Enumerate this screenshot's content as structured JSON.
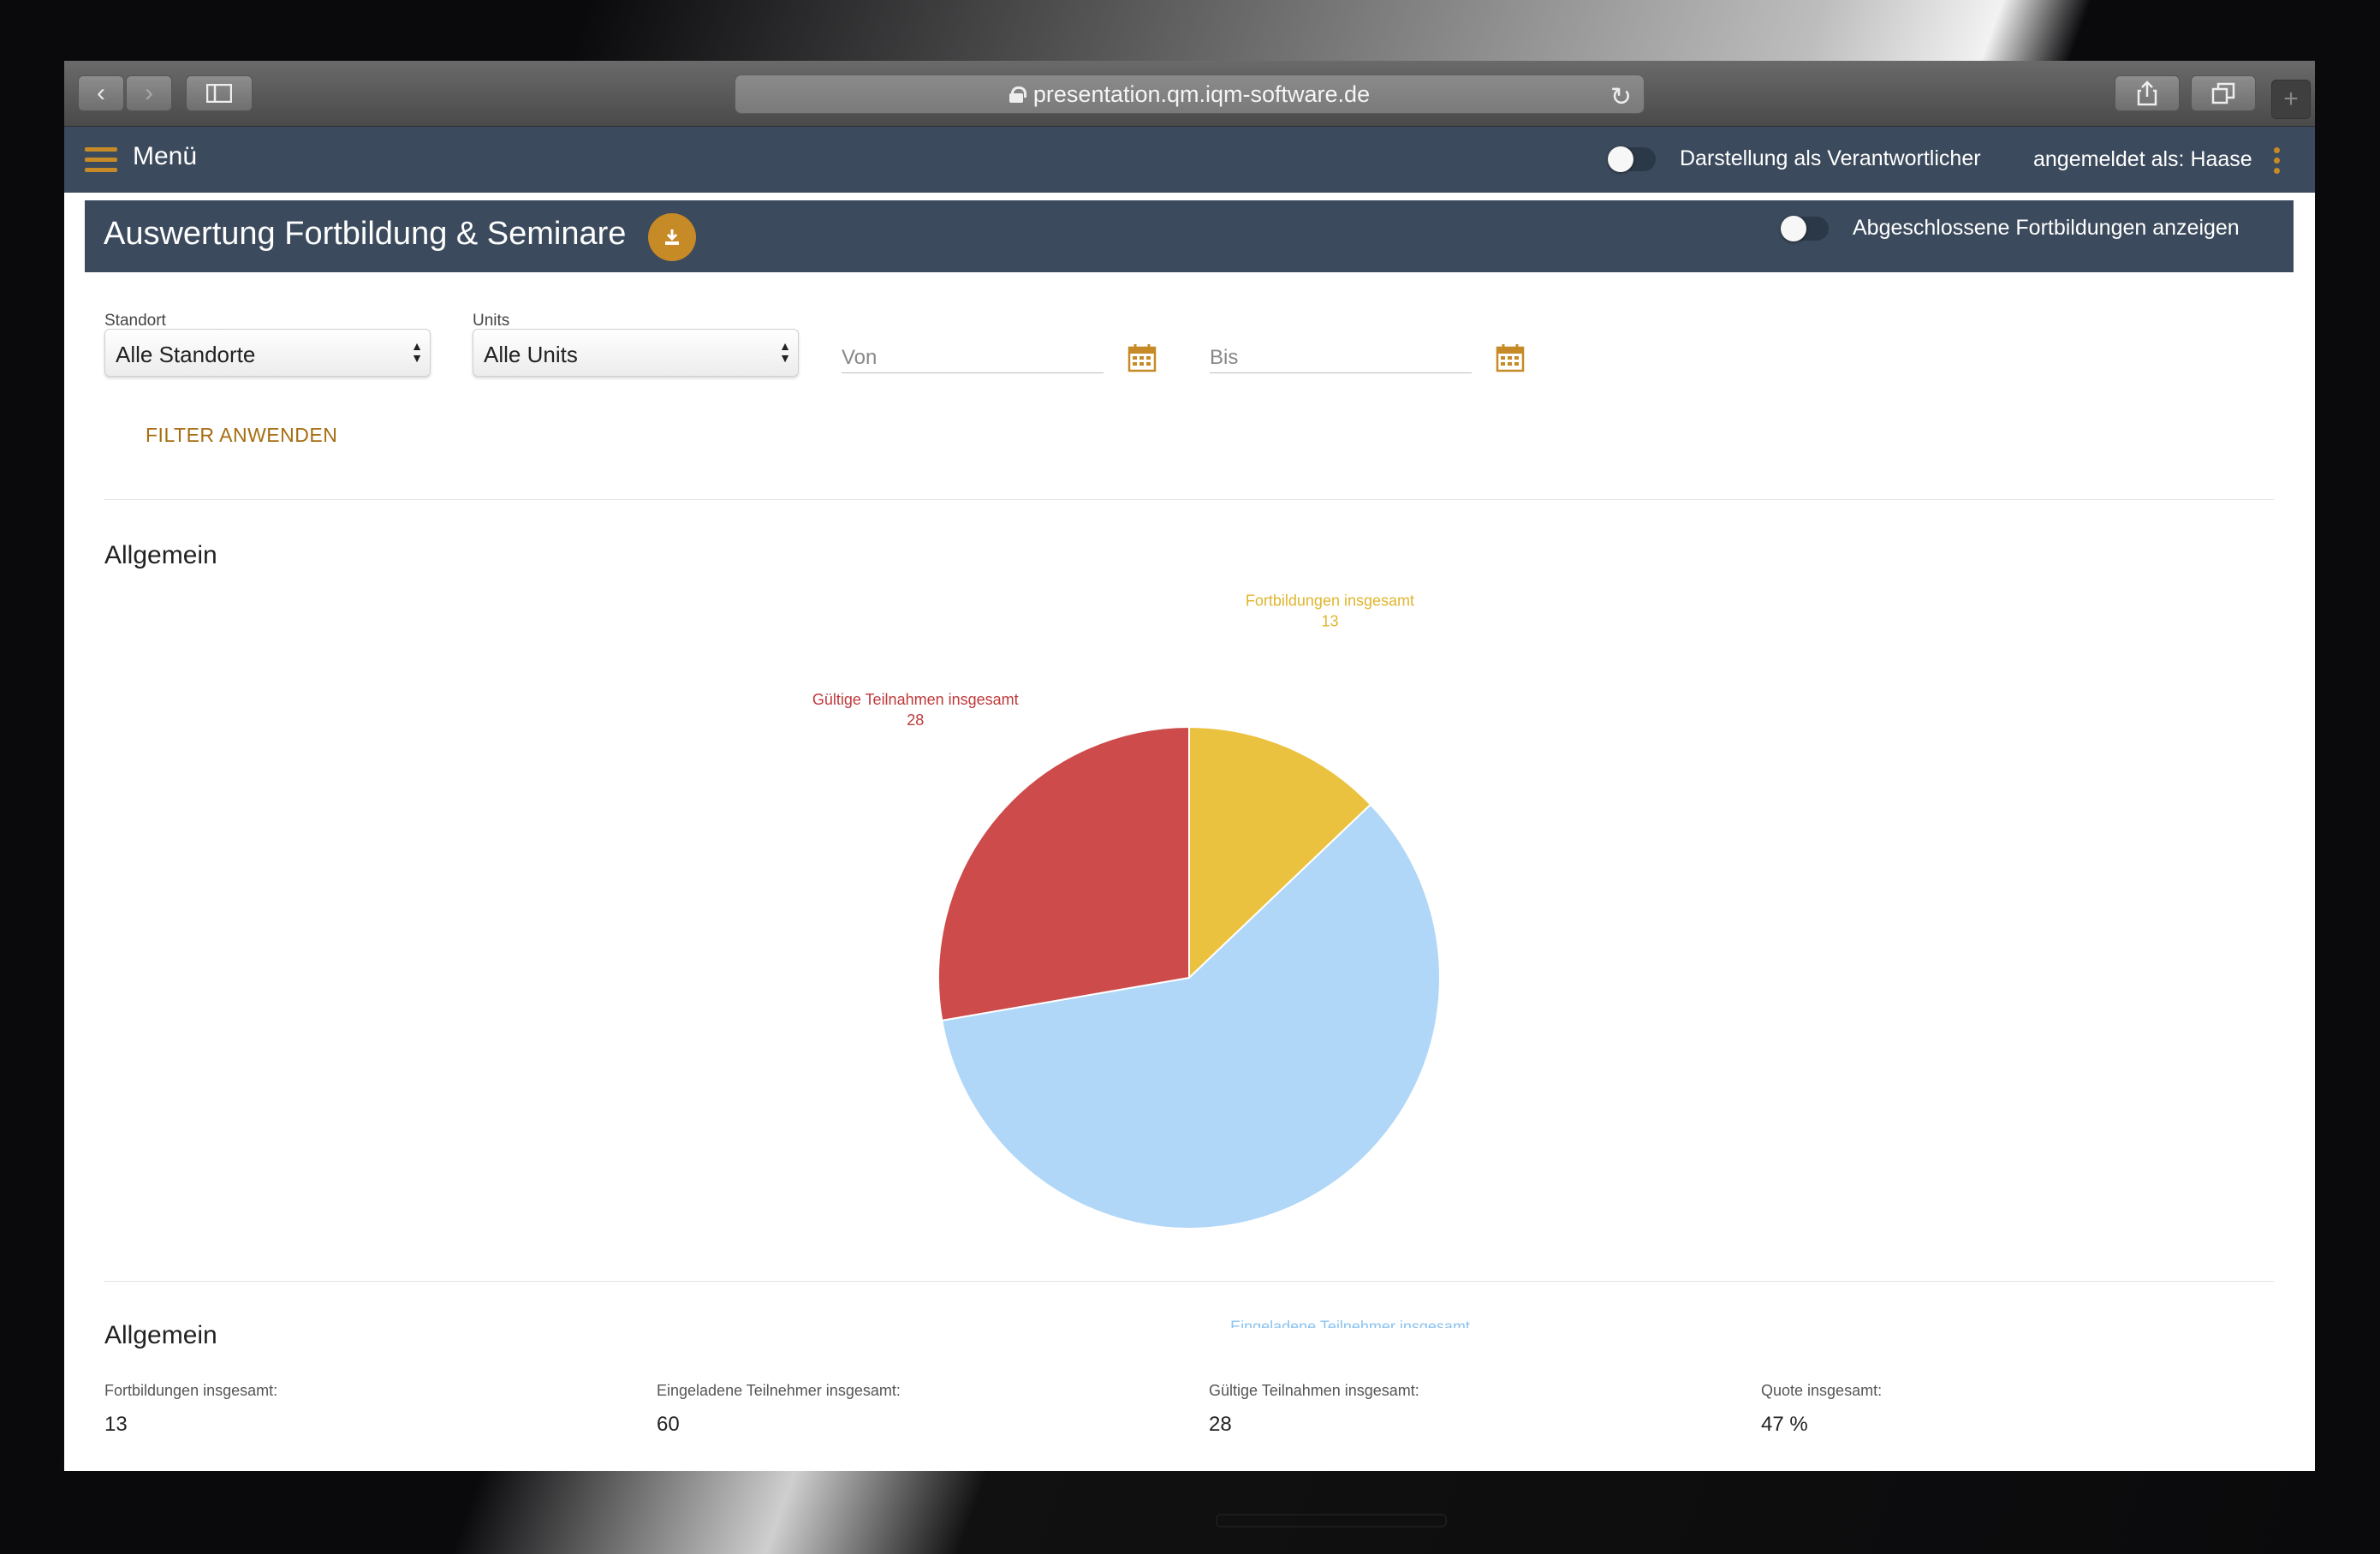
{
  "browser": {
    "url": "presentation.qm.iqm-software.de"
  },
  "nav": {
    "menu_label": "Menü",
    "responsible_toggle_label": "Darstellung als Verantwortlicher",
    "logged_in_label": "angemeldet als: Haase"
  },
  "header": {
    "title": "Auswertung Fortbildung & Seminare",
    "completed_toggle_label": "Abgeschlossene Fortbildungen anzeigen"
  },
  "filters": {
    "standort_label": "Standort",
    "standort_value": "Alle Standorte",
    "units_label": "Units",
    "units_value": "Alle Units",
    "von_placeholder": "Von",
    "bis_placeholder": "Bis",
    "apply_label": "FILTER ANWENDEN"
  },
  "sections": {
    "chart_title": "Allgemein",
    "stats_title": "Allgemein"
  },
  "chart_data": {
    "type": "pie",
    "slices": [
      {
        "label": "Fortbildungen insgesamt",
        "value": 13,
        "color": "#ebc23f"
      },
      {
        "label": "Eingeladene Teilnehmer insgesamt",
        "value": 60,
        "color": "#b0d7f7"
      },
      {
        "label": "Gültige Teilnahmen insgesamt",
        "value": 28,
        "color": "#cd4b4b"
      }
    ]
  },
  "stats": [
    {
      "label": "Fortbildungen insgesamt:",
      "value": "13"
    },
    {
      "label": "Eingeladene Teilnehmer insgesamt:",
      "value": "60"
    },
    {
      "label": "Gültige Teilnahmen insgesamt:",
      "value": "28"
    },
    {
      "label": "Quote insgesamt:",
      "value": "47 %"
    }
  ],
  "colors": {
    "nav_bg": "#3b4a5c",
    "accent": "#c68a26"
  }
}
